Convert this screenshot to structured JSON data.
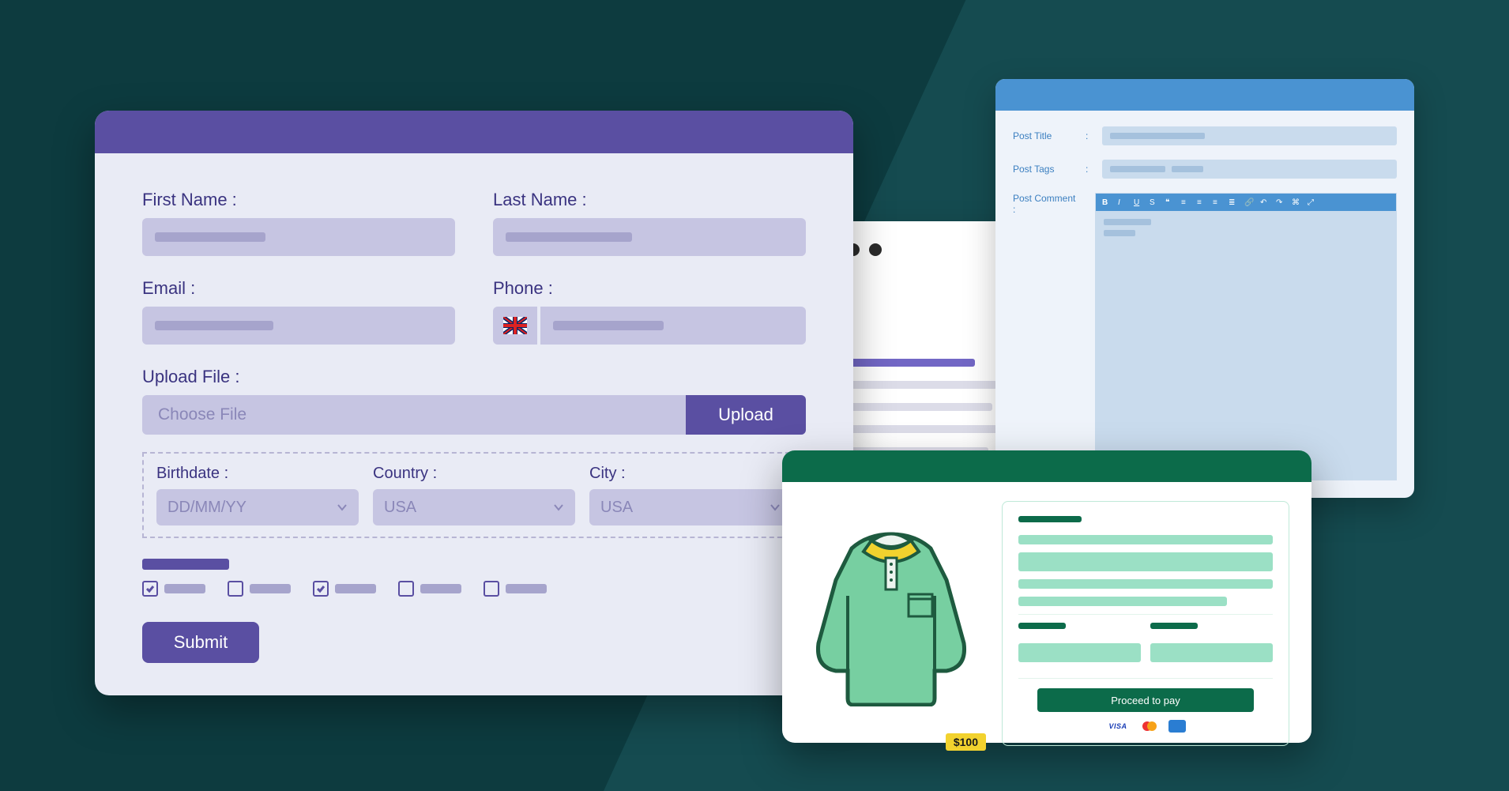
{
  "form": {
    "labels": {
      "first_name": "First Name :",
      "last_name": "Last Name :",
      "email": "Email :",
      "phone": "Phone :",
      "upload": "Upload File :",
      "upload_placeholder": "Choose File",
      "upload_button": "Upload",
      "birthdate": "Birthdate :",
      "country": "Country :",
      "city": "City :",
      "submit": "Submit"
    },
    "selects": {
      "birthdate_placeholder": "DD/MM/YY",
      "country_value": "USA",
      "city_value": "USA"
    },
    "phone_flag": "uk",
    "checkboxes": [
      {
        "checked": true
      },
      {
        "checked": false
      },
      {
        "checked": true
      },
      {
        "checked": false
      },
      {
        "checked": false
      }
    ]
  },
  "editor": {
    "labels": {
      "title": "Post Title",
      "tags": "Post Tags",
      "comment": "Post Comment :",
      "colon": ":"
    },
    "toolbar_icons": [
      "bold",
      "italic",
      "underline",
      "strike",
      "quote",
      "align-left",
      "align-center",
      "align-right",
      "list",
      "link",
      "undo",
      "redo",
      "code",
      "expand"
    ]
  },
  "checkout": {
    "price": "$100",
    "pay_button": "Proceed to pay",
    "cards": {
      "visa": "VISA"
    }
  }
}
